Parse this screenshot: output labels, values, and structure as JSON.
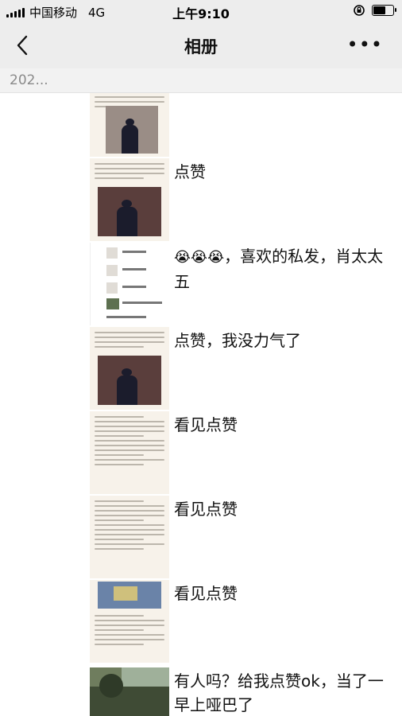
{
  "status_bar": {
    "carrier": "中国移动",
    "network": "4G",
    "time": "上午9:10",
    "battery_level": 0.7
  },
  "nav": {
    "title": "相册",
    "more": "•••"
  },
  "year_label": "202...",
  "posts": [
    {
      "caption": ""
    },
    {
      "caption": "点赞"
    },
    {
      "emoji": "😭😭😭",
      "caption": "，喜欢的私发，肖太太五"
    },
    {
      "caption": "点赞，我没力气了"
    },
    {
      "caption": "看见点赞"
    },
    {
      "caption": "看见点赞"
    },
    {
      "caption": "看见点赞"
    },
    {
      "caption": "有人吗？给我点赞ok，当了一早上哑巴了"
    }
  ]
}
